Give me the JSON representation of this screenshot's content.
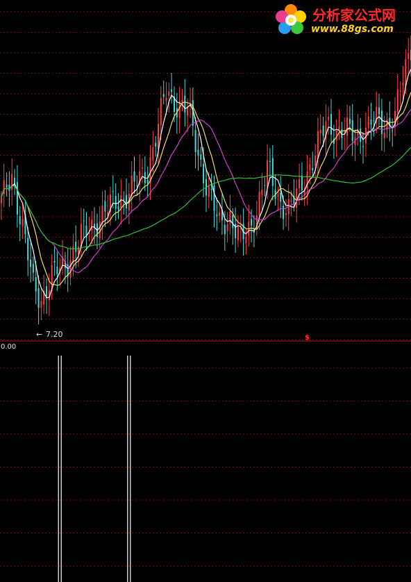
{
  "logo": {
    "title": "分析家公式网",
    "url": "www.88gs.com",
    "icon": "flower-logo-icon"
  },
  "colors": {
    "background": "#000000",
    "grid": "#7a1010",
    "divider": "#c81414",
    "candle_up": "#ff4040",
    "candle_down": "#44dcdc",
    "ma_short": "#ffffff",
    "ma_mid": "#f0e060",
    "ma_long": "#d040d0",
    "ma_longest": "#30c030",
    "indicator": "#ffffff"
  },
  "main_chart": {
    "low_marker": {
      "arrow": "←",
      "value": "7.20"
    },
    "signal_marker": "$"
  },
  "indicator_panel": {
    "current_value": "0.00",
    "spikes": [
      {
        "bar_index": 22,
        "value": 1
      },
      {
        "bar_index": 48,
        "value": 1
      }
    ]
  },
  "chart_data": {
    "type": "line",
    "title": "",
    "xlabel": "",
    "ylabel": "",
    "bar_count": 155,
    "close_waypoints": [
      {
        "bar": 0,
        "close": 9.0
      },
      {
        "bar": 4,
        "close": 9.5
      },
      {
        "bar": 8,
        "close": 8.6
      },
      {
        "bar": 12,
        "close": 7.5
      },
      {
        "bar": 15,
        "close": 7.3
      },
      {
        "bar": 19,
        "close": 7.7
      },
      {
        "bar": 24,
        "close": 7.9
      },
      {
        "bar": 30,
        "close": 8.4
      },
      {
        "bar": 36,
        "close": 8.7
      },
      {
        "bar": 42,
        "close": 9.0
      },
      {
        "bar": 48,
        "close": 9.2
      },
      {
        "bar": 55,
        "close": 9.6
      },
      {
        "bar": 62,
        "close": 11.0
      },
      {
        "bar": 66,
        "close": 10.8
      },
      {
        "bar": 70,
        "close": 10.7
      },
      {
        "bar": 74,
        "close": 9.9
      },
      {
        "bar": 78,
        "close": 9.2
      },
      {
        "bar": 82,
        "close": 8.6
      },
      {
        "bar": 86,
        "close": 8.8
      },
      {
        "bar": 90,
        "close": 8.3
      },
      {
        "bar": 94,
        "close": 8.6
      },
      {
        "bar": 100,
        "close": 9.6
      },
      {
        "bar": 104,
        "close": 9.1
      },
      {
        "bar": 108,
        "close": 8.9
      },
      {
        "bar": 112,
        "close": 9.2
      },
      {
        "bar": 116,
        "close": 9.7
      },
      {
        "bar": 122,
        "close": 10.4
      },
      {
        "bar": 128,
        "close": 10.3
      },
      {
        "bar": 134,
        "close": 10.2
      },
      {
        "bar": 140,
        "close": 10.5
      },
      {
        "bar": 144,
        "close": 10.4
      },
      {
        "bar": 148,
        "close": 10.6
      },
      {
        "bar": 151,
        "close": 11.2
      },
      {
        "bar": 154,
        "close": 11.8
      }
    ],
    "series": [
      {
        "period": 5
      },
      {
        "period": 10
      },
      {
        "period": 20
      },
      {
        "period": 60
      }
    ],
    "ylim": [
      6.9,
      11.9
    ],
    "grid": true,
    "lowest_price_label": "7.20",
    "indicator_ylim": [
      0,
      1
    ]
  }
}
